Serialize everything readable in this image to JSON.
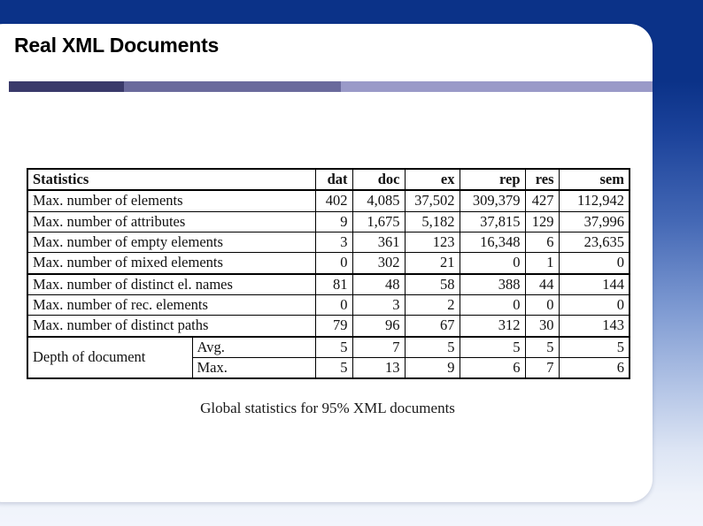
{
  "slide": {
    "title": "Real XML Documents",
    "background_top_color": "#0b3288",
    "background_bottom_color": "#f2f5fc",
    "panel_color": "#ffffff"
  },
  "accent_bar": {
    "segments": [
      {
        "name": "dark",
        "color": "#3a3a6a"
      },
      {
        "name": "mid",
        "color": "#6a6a9c"
      },
      {
        "name": "light",
        "color": "#9a9ac8"
      }
    ]
  },
  "table": {
    "columns": [
      "Statistics",
      "dat",
      "doc",
      "ex",
      "rep",
      "res",
      "sem"
    ],
    "rows": [
      {
        "label": "Max. number of elements",
        "values": [
          "402",
          "4,085",
          "37,502",
          "309,379",
          "427",
          "112,942"
        ]
      },
      {
        "label": "Max. number of attributes",
        "values": [
          "9",
          "1,675",
          "5,182",
          "37,815",
          "129",
          "37,996"
        ]
      },
      {
        "label": "Max. number of empty elements",
        "values": [
          "3",
          "361",
          "123",
          "16,348",
          "6",
          "23,635"
        ]
      },
      {
        "label": "Max. number of mixed elements",
        "values": [
          "0",
          "302",
          "21",
          "0",
          "1",
          "0"
        ]
      },
      {
        "label": "Max. number of distinct el. names",
        "values": [
          "81",
          "48",
          "58",
          "388",
          "44",
          "144"
        ]
      },
      {
        "label": "Max. number of rec. elements",
        "values": [
          "0",
          "3",
          "2",
          "0",
          "0",
          "0"
        ]
      },
      {
        "label": "Max. number of distinct paths",
        "values": [
          "79",
          "96",
          "67",
          "312",
          "30",
          "143"
        ]
      }
    ],
    "depth_group": {
      "label": "Depth of document",
      "subrows": [
        {
          "label": "Avg.",
          "values": [
            "5",
            "7",
            "5",
            "5",
            "5",
            "5"
          ]
        },
        {
          "label": "Max.",
          "values": [
            "5",
            "13",
            "9",
            "6",
            "7",
            "6"
          ]
        }
      ]
    }
  },
  "caption": "Global statistics for 95% XML documents"
}
